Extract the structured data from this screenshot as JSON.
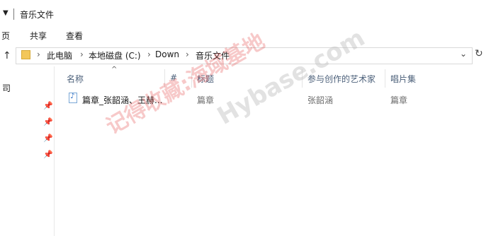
{
  "window": {
    "title": "音乐文件"
  },
  "ribbon": {
    "tabs": [
      "页",
      "共享",
      "查看"
    ]
  },
  "address": {
    "breadcrumbs": [
      "此电脑",
      "本地磁盘 (C:)",
      "Down",
      "音乐文件"
    ]
  },
  "nav": {
    "visible_char": "司"
  },
  "columns": [
    "名称",
    "#",
    "标题",
    "参与创作的艺术家",
    "唱片集"
  ],
  "rows": [
    {
      "name": "篇章_张韶涵、王赫...",
      "number": "",
      "title": "篇章",
      "artist": "张韶涵",
      "album": "篇章"
    }
  ],
  "watermarks": {
    "cn": "记得收藏:海域基地",
    "en": "Hybase.com"
  }
}
